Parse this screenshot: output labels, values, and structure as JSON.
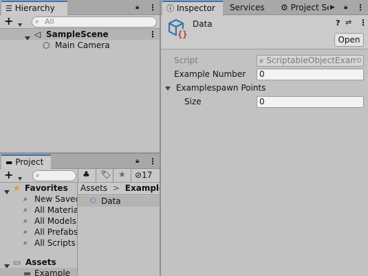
{
  "hierarchy": {
    "tab_label": "Hierarchy",
    "add_label": "+",
    "search_placeholder": "All",
    "scene_name": "SampleScene",
    "items": [
      {
        "label": "Main Camera"
      }
    ]
  },
  "project": {
    "tab_label": "Project",
    "add_label": "+",
    "hidden_count": "17",
    "favorites_label": "Favorites",
    "favorites": [
      {
        "label": "New Saved"
      },
      {
        "label": "All Materia"
      },
      {
        "label": "All Models"
      },
      {
        "label": "All Prefabs"
      },
      {
        "label": "All Scripts"
      }
    ],
    "assets_label": "Assets",
    "asset_folders": [
      {
        "label": "Example"
      }
    ],
    "breadcrumb": {
      "root": "Assets",
      "separator": ">",
      "current": "Example"
    },
    "files": [
      {
        "label": "Data"
      }
    ]
  },
  "inspector": {
    "tabs": [
      {
        "label": "Inspector"
      },
      {
        "label": "Services"
      },
      {
        "label": "Project Se"
      }
    ],
    "title": "Data",
    "open_button": "Open",
    "script_label": "Script",
    "script_value": "ScriptableObjectExam",
    "example_number_label": "Example Number",
    "example_number_value": "0",
    "spawn_points_label": "Examplespawn Points",
    "size_label": "Size",
    "size_value": "0"
  },
  "colors": {
    "accent": "#3a72b0",
    "panel": "#c2c2c2",
    "tabbar": "#a8a8a8",
    "selection": "#b4b4b4",
    "script_icon": "#c03030"
  }
}
